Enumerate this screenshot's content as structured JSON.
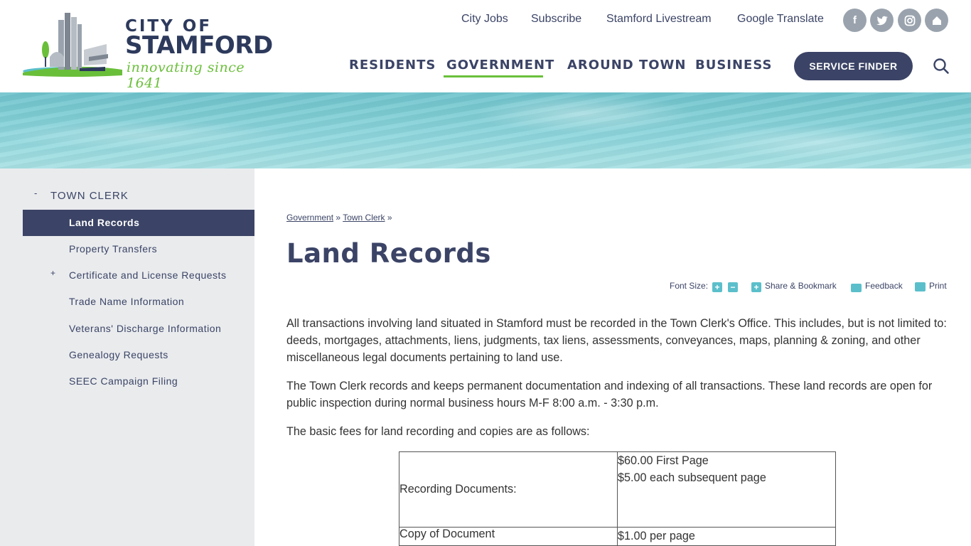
{
  "header": {
    "logo": {
      "city_of": "CITY OF",
      "name": "STAMFORD",
      "tagline": "innovating since 1641"
    },
    "utility_links": [
      "City Jobs",
      "Subscribe",
      "Stamford Livestream",
      "Google Translate"
    ],
    "social_icons": [
      "facebook-icon",
      "twitter-icon",
      "instagram-icon",
      "nextdoor-icon"
    ],
    "main_nav": [
      {
        "label": "RESIDENTS",
        "active": false
      },
      {
        "label": "GOVERNMENT",
        "active": true
      },
      {
        "label": "AROUND TOWN",
        "active": false
      },
      {
        "label": "BUSINESS",
        "active": false
      }
    ],
    "service_finder_label": "SERVICE FINDER",
    "accent_color": "#6abf3a",
    "brand_color": "#3b4466"
  },
  "sidebar": {
    "toggle": "-",
    "heading": "TOWN CLERK",
    "items": [
      {
        "label": "Land Records",
        "active": true,
        "expandable": false
      },
      {
        "label": "Property Transfers",
        "active": false,
        "expandable": false
      },
      {
        "label": "Certificate and License Requests",
        "active": false,
        "expandable": true,
        "toggle": "+"
      },
      {
        "label": "Trade Name Information",
        "active": false,
        "expandable": false
      },
      {
        "label": "Veterans' Discharge Information",
        "active": false,
        "expandable": false
      },
      {
        "label": "Genealogy Requests",
        "active": false,
        "expandable": false
      },
      {
        "label": "SEEC Campaign Filing",
        "active": false,
        "expandable": false
      }
    ]
  },
  "content": {
    "breadcrumb": [
      {
        "label": "Government"
      },
      {
        "label": "Town Clerk"
      }
    ],
    "breadcrumb_sep": "»",
    "title": "Land Records",
    "tools": {
      "font_size_label": "Font Size:",
      "increase": "+",
      "decrease": "−",
      "share_label": "Share & Bookmark",
      "share_icon": "+",
      "feedback_label": "Feedback",
      "print_label": "Print"
    },
    "paragraphs": [
      "All transactions involving land situated in Stamford must be recorded in the Town Clerk's Office. This includes, but is not limited to: deeds, mortgages, attachments, liens, judgments, tax liens, assessments, conveyances, maps, planning & zoning, and other miscellaneous legal documents pertaining to land use.",
      "The Town Clerk records and keeps permanent documentation and indexing of all transactions. These land records are open for public inspection during normal business hours M-F 8:00 a.m. - 3:30 p.m.",
      "The basic fees for land recording and copies are as follows:"
    ],
    "fee_table": [
      {
        "label": "Recording Documents:",
        "values": [
          "$60.00 First Page",
          "$5.00 each subsequent page"
        ]
      },
      {
        "label": "Copy of Document",
        "values": [
          "$1.00 per page"
        ]
      }
    ]
  }
}
